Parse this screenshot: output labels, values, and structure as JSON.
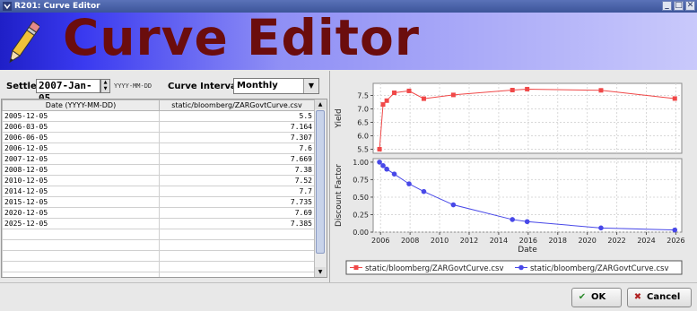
{
  "window": {
    "title": "R201: Curve Editor",
    "minimize_glyph": "_",
    "maximize_glyph": "□",
    "close_glyph": "✕"
  },
  "banner": {
    "title": "Curve Editor",
    "icon": "pencil-icon"
  },
  "controls": {
    "settle_label": "Settle",
    "settle_value": "2007-Jan-05",
    "date_format_hint": "YYYY-MM-DD",
    "curve_interval_label": "Curve Interval",
    "curve_interval_value": "Monthly"
  },
  "table": {
    "columns": [
      "Date (YYYY-MM-DD)",
      "static/bloomberg/ZARGovtCurve.csv"
    ],
    "rows": [
      [
        "2005-12-05",
        "5.5"
      ],
      [
        "2006-03-05",
        "7.164"
      ],
      [
        "2006-06-05",
        "7.307"
      ],
      [
        "2006-12-05",
        "7.6"
      ],
      [
        "2007-12-05",
        "7.669"
      ],
      [
        "2008-12-05",
        "7.38"
      ],
      [
        "2010-12-05",
        "7.52"
      ],
      [
        "2014-12-05",
        "7.7"
      ],
      [
        "2015-12-05",
        "7.735"
      ],
      [
        "2020-12-05",
        "7.69"
      ],
      [
        "2025-12-05",
        "7.385"
      ]
    ],
    "empty_rows": 5
  },
  "chart_data": [
    {
      "type": "line",
      "title": "",
      "xlabel": "",
      "ylabel": "Yield",
      "ylim": [
        5.35,
        7.95
      ],
      "yticks": [
        "5.5",
        "6.0",
        "6.5",
        "7.0",
        "7.5"
      ],
      "ytick_values": [
        5.5,
        6.0,
        6.5,
        7.0,
        7.5
      ],
      "xlim": [
        2005.5,
        2026.4
      ],
      "color": "#f04848",
      "marker": "square",
      "series": [
        {
          "name": "static/bloomberg/ZARGovtCurve.csv",
          "x": [
            2005.93,
            2006.17,
            2006.42,
            2006.93,
            2007.93,
            2008.93,
            2010.93,
            2014.93,
            2015.93,
            2020.93,
            2025.93
          ],
          "values": [
            5.5,
            7.164,
            7.307,
            7.6,
            7.669,
            7.38,
            7.52,
            7.7,
            7.735,
            7.69,
            7.385
          ]
        }
      ],
      "grid": true
    },
    {
      "type": "line",
      "title": "",
      "xlabel": "Date",
      "ylabel": "Discount Factor",
      "ylim": [
        0.0,
        1.05
      ],
      "yticks": [
        "0.00",
        "0.25",
        "0.50",
        "0.75",
        "1.00"
      ],
      "ytick_values": [
        0.0,
        0.25,
        0.5,
        0.75,
        1.0
      ],
      "xlim": [
        2005.5,
        2026.4
      ],
      "xticks": [
        "2006",
        "2008",
        "2010",
        "2012",
        "2014",
        "2016",
        "2018",
        "2020",
        "2022",
        "2024",
        "2026"
      ],
      "xtick_values": [
        2006,
        2008,
        2010,
        2012,
        2014,
        2016,
        2018,
        2020,
        2022,
        2024,
        2026
      ],
      "color": "#4848e8",
      "marker": "circle",
      "series": [
        {
          "name": "static/bloomberg/ZARGovtCurve.csv",
          "x": [
            2005.93,
            2006.17,
            2006.42,
            2006.93,
            2007.93,
            2008.93,
            2010.93,
            2014.93,
            2015.93,
            2020.93,
            2025.93
          ],
          "values": [
            1.0,
            0.95,
            0.9,
            0.83,
            0.69,
            0.58,
            0.39,
            0.18,
            0.15,
            0.06,
            0.03
          ]
        }
      ],
      "grid": true
    }
  ],
  "legend": {
    "placement": "bottom",
    "items": [
      "static/bloomberg/ZARGovtCurve.csv",
      "static/bloomberg/ZARGovtCurve.csv"
    ]
  },
  "buttons": {
    "ok_label": "OK",
    "cancel_label": "Cancel",
    "ok_icon": "✔",
    "cancel_icon": "✖"
  }
}
